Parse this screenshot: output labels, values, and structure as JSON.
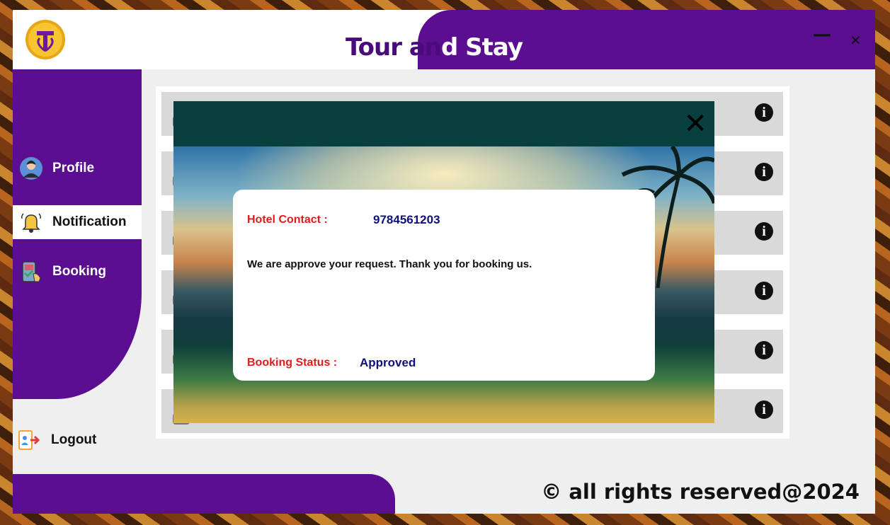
{
  "app": {
    "title_part1": "Tour an",
    "title_part2": "d Stay",
    "minimize": "—",
    "close": "✕",
    "logo_letter": "T"
  },
  "sidebar": {
    "items": [
      {
        "label": "Profile",
        "icon": "user-avatar-icon"
      },
      {
        "label": "Notification",
        "icon": "bell-icon",
        "active": true
      },
      {
        "label": "Booking",
        "icon": "booking-phone-icon"
      }
    ],
    "logout": {
      "label": "Logout",
      "icon": "logout-icon"
    }
  },
  "notifications": {
    "row_count": 6,
    "info_icon": "i"
  },
  "modal": {
    "close": "✕",
    "contact_label": "Hotel Contact :",
    "contact_value": "9784561203",
    "message": "We are approve your request. Thank you for booking us.",
    "status_label": "Booking Status :",
    "status_value": "Approved"
  },
  "footer": {
    "text": "© all rights reserved@2024"
  },
  "colors": {
    "purple": "#5b0f90",
    "modal_header": "#07403f",
    "label_red": "#e21b1b",
    "value_blue": "#10107a"
  }
}
